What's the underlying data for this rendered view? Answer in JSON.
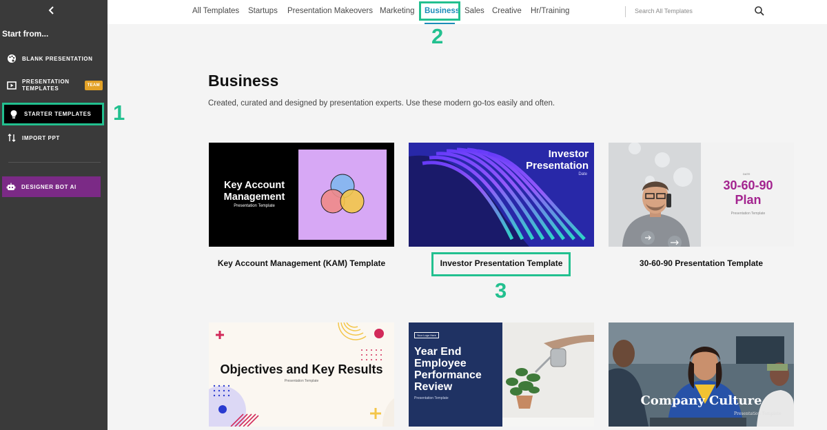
{
  "sidebar": {
    "start_label": "Start from...",
    "items": [
      {
        "label": "BLANK PRESENTATION",
        "icon": "palette-icon"
      },
      {
        "label_line1": "PRESENTATION",
        "label_line2": "TEMPLATES",
        "badge": "TEAM",
        "icon": "play-slides-icon"
      },
      {
        "label": "STARTER TEMPLATES",
        "icon": "lightbulb-icon"
      },
      {
        "label": "IMPORT PPT",
        "icon": "import-arrows-icon"
      },
      {
        "label": "DESIGNER BOT AI",
        "icon": "bot-icon"
      }
    ]
  },
  "nav": {
    "tabs": [
      "All Templates",
      "Startups",
      "Presentation Makeovers",
      "Marketing",
      "Business",
      "Sales",
      "Creative",
      "Hr/Training"
    ],
    "active": "Business",
    "search_placeholder": "Search All Templates"
  },
  "main": {
    "title": "Business",
    "description": "Created, curated and designed by presentation experts. Use these modern go-tos easily and often."
  },
  "templates": [
    {
      "label": "Key Account Management (KAM) Template",
      "thumb_title": "Key Account Management",
      "thumb_sub": "Presentation Template"
    },
    {
      "label": "Investor Presentation Template",
      "thumb_title_1": "Investor",
      "thumb_title_2": "Presentation",
      "thumb_sub": "Date"
    },
    {
      "label": "30-60-90 Presentation Template",
      "thumb_date": "DATE",
      "thumb_title_1": "30-60-90",
      "thumb_title_2": "Plan",
      "thumb_sub": "Presentation Template"
    },
    {
      "thumb_title": "Objectives and Key Results",
      "thumb_sub": "Presentation Template"
    },
    {
      "thumb_logo": "Your Logo Here",
      "thumb_title": "Year End Employee Performance Review",
      "thumb_sub": "Presentation Template"
    },
    {
      "thumb_title": "Company Culture",
      "thumb_sub": "Presentation Template"
    }
  ],
  "annotations": [
    "1",
    "2",
    "3"
  ],
  "colors": {
    "accent": "#22c08f",
    "active_tab": "#1b8cb8",
    "sidebar_bg": "#3a3a3a",
    "bot_bg": "#7b2a86",
    "team_badge": "#e3a227"
  }
}
